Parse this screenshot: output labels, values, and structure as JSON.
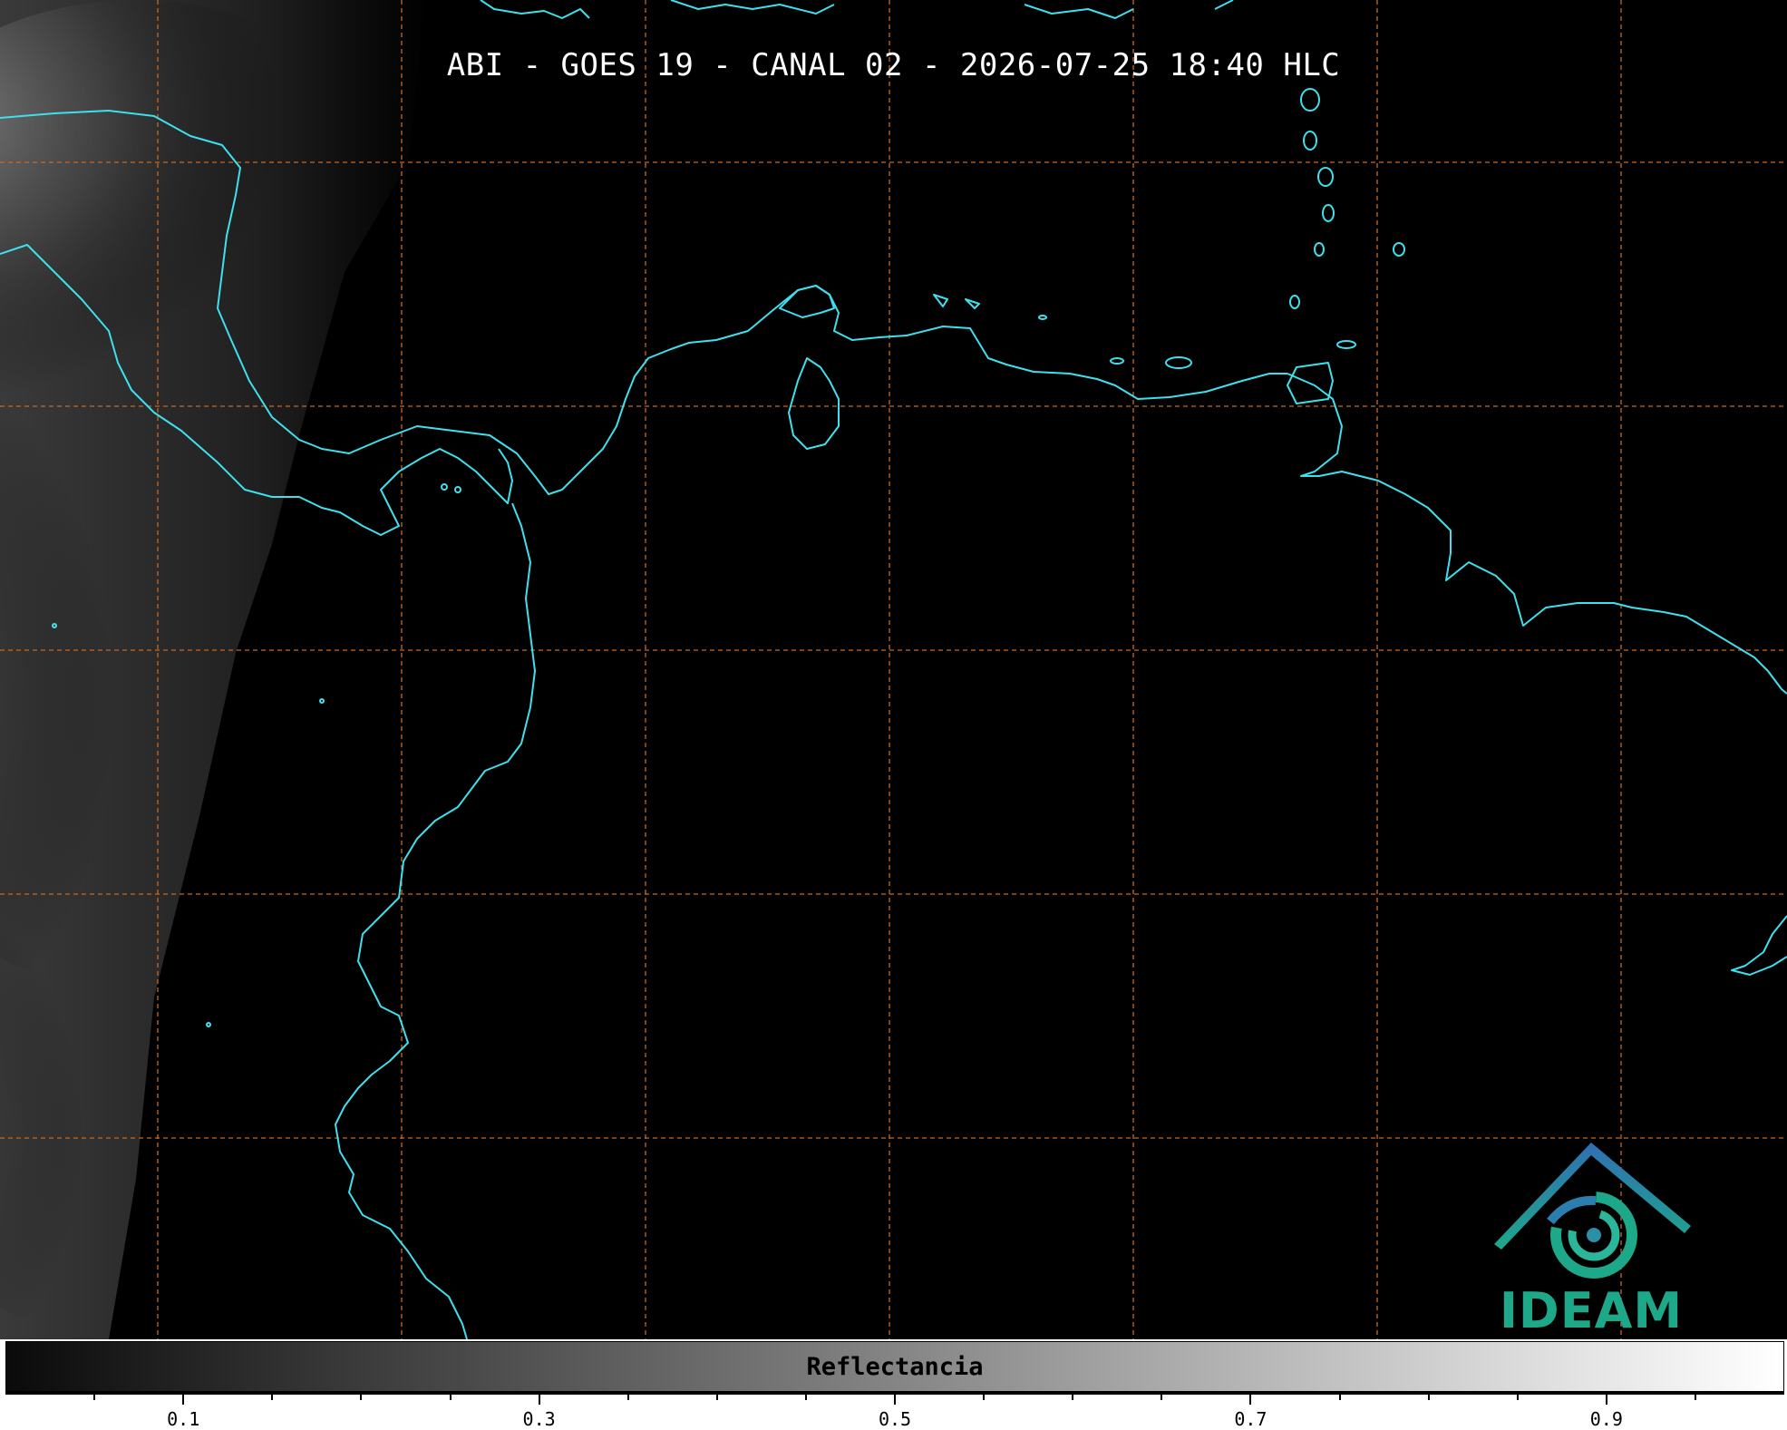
{
  "title": "ABI - GOES 19 - CANAL 02 - 2026-07-25 18:40 HLC",
  "logo": {
    "name": "IDEAM",
    "text": "IDEAM",
    "colors": {
      "top": "#2f6fb4",
      "bottom": "#1ea88a"
    }
  },
  "colorbar": {
    "label": "Reflectancia",
    "range": [
      0.0,
      1.0
    ],
    "ticks": [
      "0.1",
      "0.3",
      "0.5",
      "0.7",
      "0.9"
    ],
    "tick_values": [
      0.1,
      0.3,
      0.5,
      0.7,
      0.9
    ],
    "minor_tick_step": 0.05,
    "colormap": "grayscale black-to-white"
  },
  "map": {
    "coastline_color": "#3ee0ee",
    "gridline_color": "#c8681e",
    "gridline_style": "dashed",
    "background": "#000000"
  }
}
